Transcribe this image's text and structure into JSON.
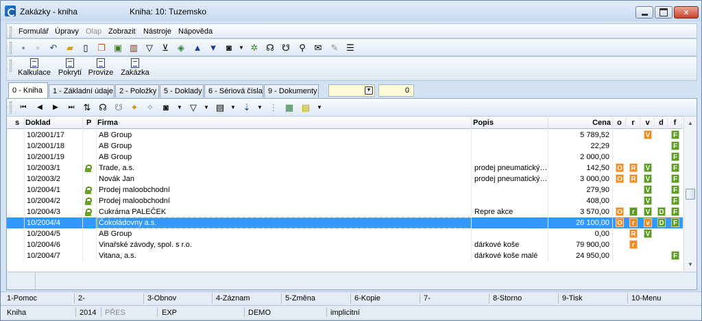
{
  "window": {
    "title": "Zakázky - kniha",
    "subtitle": "Kniha: 10: Tuzemsko"
  },
  "menu": [
    {
      "label": "Formulář",
      "disabled": false
    },
    {
      "label": "Úpravy",
      "disabled": false
    },
    {
      "label": "Olap",
      "disabled": true
    },
    {
      "label": "Zobrazit",
      "disabled": false
    },
    {
      "label": "Nástroje",
      "disabled": false
    },
    {
      "label": "Nápověda",
      "disabled": false
    }
  ],
  "toolbar2": [
    {
      "label": "Kalkulace"
    },
    {
      "label": "Pokrytí"
    },
    {
      "label": "Provize"
    },
    {
      "label": "Zakázka"
    }
  ],
  "tabs": [
    {
      "label": "0 - Kniha",
      "active": true
    },
    {
      "label": "1 - Základní údaje",
      "active": false
    },
    {
      "label": "2 - Položky",
      "active": false
    },
    {
      "label": "5 - Doklady",
      "active": false
    },
    {
      "label": "6 - Sériová čísla",
      "active": false
    },
    {
      "label": "9 - Dokumenty",
      "active": false
    }
  ],
  "filter": {
    "combo_value": "",
    "count": "0"
  },
  "columns": {
    "s": "s",
    "doklad": "Doklad",
    "p": "P",
    "firma": "Firma",
    "popis": "Popis",
    "cena": "Cena",
    "o": "o",
    "r": "r",
    "v": "v",
    "d": "d",
    "f": "f"
  },
  "rows": [
    {
      "doklad": "10/2001/17",
      "lock": false,
      "firma": "AB Group",
      "popis": "",
      "cena": "5 789,52",
      "o": "",
      "r": "",
      "v": "V",
      "d": "",
      "f": "F",
      "selected": false
    },
    {
      "doklad": "10/2001/18",
      "lock": false,
      "firma": "AB Group",
      "popis": "",
      "cena": "22,29",
      "o": "",
      "r": "",
      "v": "",
      "d": "",
      "f": "F",
      "selected": false
    },
    {
      "doklad": "10/2001/19",
      "lock": false,
      "firma": "AB Group",
      "popis": "",
      "cena": "2 000,00",
      "o": "",
      "r": "",
      "v": "",
      "d": "",
      "f": "F",
      "selected": false
    },
    {
      "doklad": "10/2003/1",
      "lock": true,
      "firma": "Trade, a.s.",
      "popis": "prodej pneumatický…",
      "cena": "142,50",
      "o": "O",
      "r": "R",
      "v": "V",
      "d": "",
      "f": "F",
      "selected": false
    },
    {
      "doklad": "10/2003/2",
      "lock": false,
      "firma": "Novák Jan",
      "popis": "prodej pneumatický…",
      "cena": "3 000,00",
      "o": "O",
      "r": "R",
      "v": "V",
      "d": "",
      "f": "F",
      "selected": false
    },
    {
      "doklad": "10/2004/1",
      "lock": true,
      "firma": "Prodej maloobchodní",
      "popis": "",
      "cena": "279,90",
      "o": "",
      "r": "",
      "v": "V",
      "d": "",
      "f": "F",
      "selected": false
    },
    {
      "doklad": "10/2004/2",
      "lock": true,
      "firma": "Prodej maloobchodní",
      "popis": "",
      "cena": "408,00",
      "o": "",
      "r": "",
      "v": "V",
      "d": "",
      "f": "F",
      "selected": false
    },
    {
      "doklad": "10/2004/3",
      "lock": true,
      "firma": "Cukrárna PALEČEK",
      "popis": "Repre akce",
      "cena": "3 570,00",
      "o": "O",
      "r": "r",
      "v": "V",
      "d": "D",
      "f": "F",
      "selected": false
    },
    {
      "doklad": "10/2004/4",
      "lock": false,
      "firma": "Čokoládovny a.s.",
      "popis": "",
      "cena": "26 100,00",
      "o": "O",
      "r": "r",
      "v": "v",
      "d": "D",
      "f": "F",
      "selected": true
    },
    {
      "doklad": "10/2004/5",
      "lock": false,
      "firma": "AB Group",
      "popis": "",
      "cena": "0,00",
      "o": "",
      "r": "R",
      "v": "V",
      "d": "",
      "f": "",
      "selected": false
    },
    {
      "doklad": "10/2004/6",
      "lock": false,
      "firma": "Vinařské závody, spol. s r.o.",
      "popis": "dárkové koše",
      "cena": "79 900,00",
      "o": "",
      "r": "r",
      "v": "",
      "d": "",
      "f": "",
      "selected": false
    },
    {
      "doklad": "10/2004/7",
      "lock": false,
      "firma": "Vitana, a.s.",
      "popis": "dárkové koše malé",
      "cena": "24 950,00",
      "o": "",
      "r": "",
      "v": "",
      "d": "",
      "f": "F",
      "selected": false
    }
  ],
  "fkeys": [
    "1-Pomoc",
    "2-",
    "3-Obnov",
    "4-Záznam",
    "5-Změna",
    "6-Kopie",
    "7-",
    "8-Storno",
    "9-Tisk",
    "10-Menu"
  ],
  "status": [
    {
      "label": "Kniha",
      "disabled": false
    },
    {
      "label": "2014",
      "disabled": false
    },
    {
      "label": "PŘES",
      "disabled": true
    },
    {
      "label": "EXP",
      "disabled": false
    },
    {
      "label": "DEMO",
      "disabled": false
    },
    {
      "label": "implicitní",
      "disabled": false
    }
  ],
  "colors": {
    "selected_row": "#3399ff",
    "badge_orange": "#ef8a1e",
    "badge_green": "#5b9a24"
  }
}
